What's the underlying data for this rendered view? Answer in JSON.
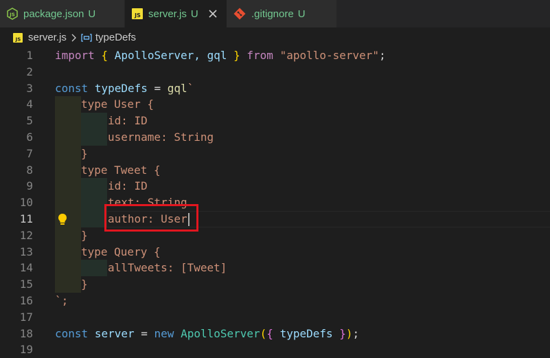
{
  "tabs": [
    {
      "name": "package.json",
      "status": "U",
      "icon": "node-js-icon",
      "active": false
    },
    {
      "name": "server.js",
      "status": "U",
      "icon": "js-icon",
      "active": true
    },
    {
      "name": ".gitignore",
      "status": "U",
      "icon": "git-icon",
      "active": false
    }
  ],
  "breadcrumb": {
    "file": "server.js",
    "symbol": "typeDefs"
  },
  "editor": {
    "current_line": 11,
    "line_numbers": [
      "1",
      "2",
      "3",
      "4",
      "5",
      "6",
      "7",
      "8",
      "9",
      "10",
      "11",
      "12",
      "13",
      "14",
      "15",
      "16",
      "17",
      "18",
      "19"
    ],
    "lines": {
      "l1": {
        "import": "import",
        "ob": "{",
        "names": " ApolloServer, gql ",
        "cb": "}",
        "from": "from",
        "mod": "\"apollo-server\"",
        "semi": ";"
      },
      "l3": {
        "const": "const",
        "name": "typeDefs",
        "eq": " = ",
        "tag": "gql",
        "tick": "`"
      },
      "l4": "type User {",
      "l5": "id: ID",
      "l6": "username: String",
      "l7": "}",
      "l8": "type Tweet {",
      "l9": "id: ID",
      "l10": "text: String",
      "l11": "author: User",
      "l12": "}",
      "l13": "type Query {",
      "l14": "allTweets: [Tweet]",
      "l15": "}",
      "l16": "`;",
      "l18": {
        "const": "const",
        "name": "server",
        "eq": " = ",
        "new": "new",
        "cls": "ApolloServer",
        "op": "(",
        "ob": "{",
        "arg": " typeDefs ",
        "cb": "}",
        "cp": ")",
        "semi": ";"
      }
    }
  },
  "colors": {
    "highlight_box": "#e2161f",
    "tab_status": "#73c991",
    "lightbulb": "#ffcc00"
  }
}
